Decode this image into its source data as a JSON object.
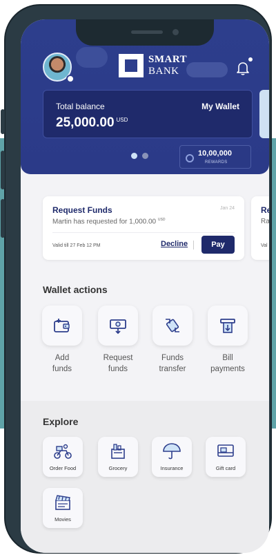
{
  "app": {
    "brand_line1": "SMART",
    "brand_line2": "BANK"
  },
  "balance": {
    "label": "Total balance",
    "wallet_label": "My Wallet",
    "amount": "25,000.00",
    "currency": "USD"
  },
  "rewards": {
    "value": "10,00,000",
    "label": "REWARDS"
  },
  "request": {
    "title": "Request Funds",
    "date": "Jan 24",
    "description": "Martin has requested for 1,000.00",
    "currency": "USD",
    "valid": "Valid till 27 Feb 12 PM",
    "decline_label": "Decline",
    "pay_label": "Pay"
  },
  "request_peek": {
    "title": "Re",
    "desc": "Ra",
    "valid": "Val"
  },
  "wallet_actions": {
    "title": "Wallet actions",
    "items": [
      {
        "line1": "Add",
        "line2": "funds",
        "icon": "wallet-plus-icon"
      },
      {
        "line1": "Request",
        "line2": "funds",
        "icon": "cash-request-icon"
      },
      {
        "line1": "Funds",
        "line2": "transfer",
        "icon": "transfer-icon"
      },
      {
        "line1": "Bill",
        "line2": "payments",
        "icon": "bill-icon"
      }
    ]
  },
  "explore": {
    "title": "Explore",
    "items": [
      {
        "label": "Order Food",
        "icon": "scooter-icon"
      },
      {
        "label": "Grocery",
        "icon": "grocery-icon"
      },
      {
        "label": "Insurance",
        "icon": "umbrella-icon"
      },
      {
        "label": "Gift card",
        "icon": "gift-card-icon"
      },
      {
        "label": "Movies",
        "icon": "clapperboard-icon"
      }
    ]
  },
  "colors": {
    "primary": "#2d3e8c",
    "dark_navy": "#1f2a6b",
    "teal_background": "#5fa3a8"
  }
}
